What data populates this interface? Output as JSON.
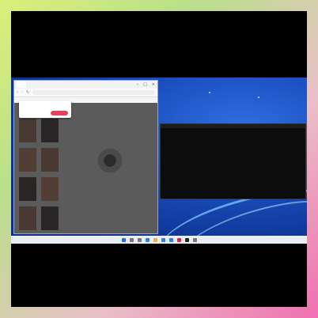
{
  "browser": {
    "tab_label": "",
    "url": "",
    "bookmarks": "",
    "popup": {
      "message": "",
      "sub": "",
      "button_label": ""
    }
  },
  "terminal": {
    "lines": [
      "",
      "",
      "",
      "",
      "",
      "",
      "",
      "",
      "",
      "",
      "",
      "",
      ""
    ]
  },
  "taskbar": {
    "icons": [
      "start-icon",
      "search-icon",
      "task-view-icon",
      "edge-icon",
      "explorer-icon",
      "store-icon",
      "mail-icon",
      "chrome-icon",
      "terminal-icon",
      "settings-icon"
    ],
    "tray_text": ""
  },
  "colors": {
    "desktop": "#1b4fbf",
    "accent_button": "#e0445a"
  }
}
